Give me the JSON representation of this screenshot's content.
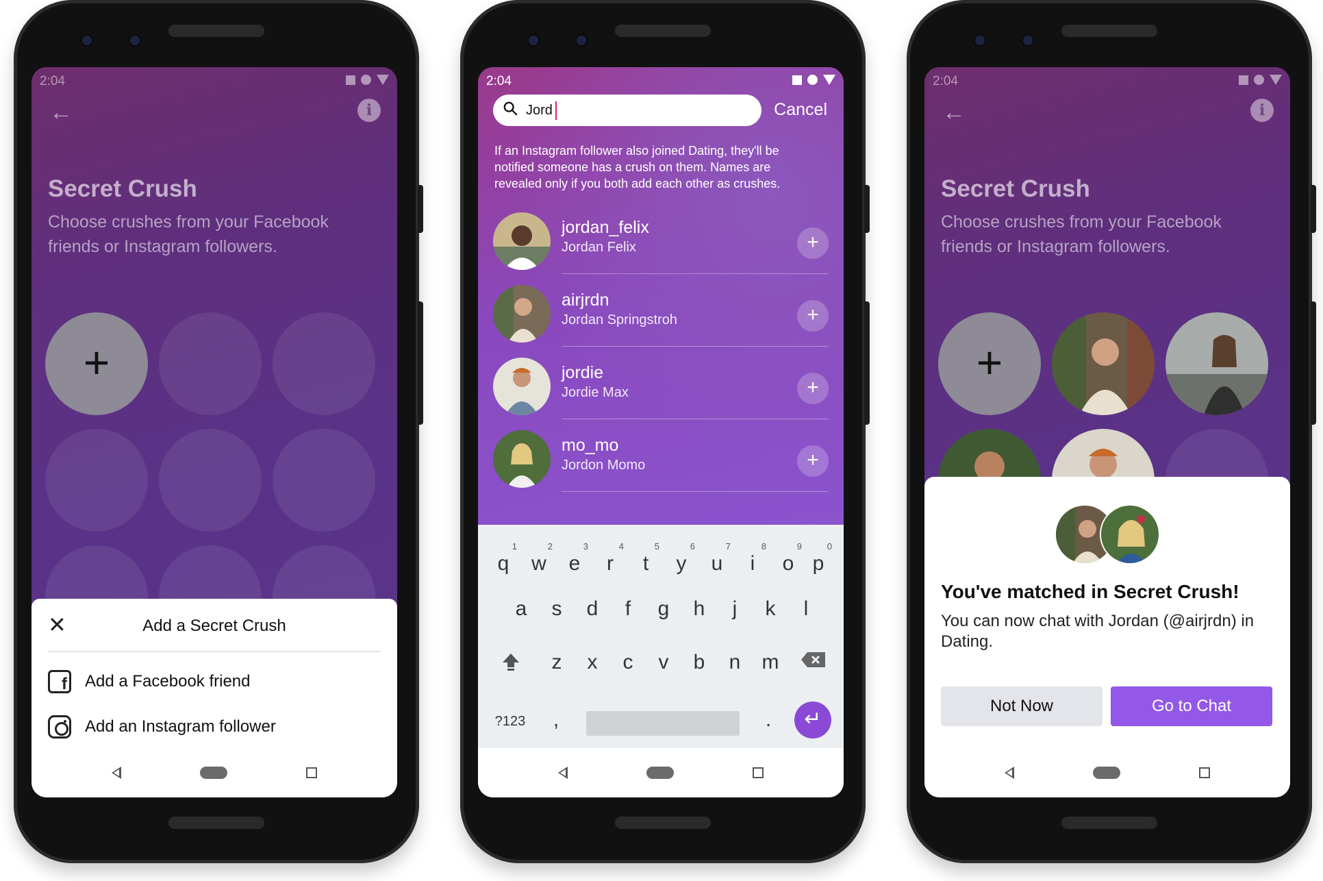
{
  "status_time": "2:04",
  "screen1": {
    "title": "Secret Crush",
    "subtitle": "Choose crushes from your Facebook friends or Instagram followers.",
    "plus": "+",
    "sheet": {
      "close": "✕",
      "title": "Add a Secret Crush",
      "options": [
        {
          "label": "Add a Facebook friend",
          "icon": "facebook-icon"
        },
        {
          "label": "Add an Instagram follower",
          "icon": "instagram-icon"
        }
      ]
    }
  },
  "screen2": {
    "search": {
      "value": "Jord",
      "cancel": "Cancel"
    },
    "notice": "If an Instagram follower also joined Dating, they'll be notified someone has a crush on them. Names are revealed only if you both add each other as crushes.",
    "results": [
      {
        "username": "jordan_felix",
        "name": "Jordan Felix",
        "add": "+"
      },
      {
        "username": "airjrdn",
        "name": "Jordan Springstroh",
        "add": "+"
      },
      {
        "username": "jordie",
        "name": "Jordie Max",
        "add": "+"
      },
      {
        "username": "mo_mo",
        "name": "Jordon Momo",
        "add": "+"
      }
    ],
    "keyboard": {
      "row1": [
        "q",
        "w",
        "e",
        "r",
        "t",
        "y",
        "u",
        "i",
        "o",
        "p"
      ],
      "row1_nums": [
        "1",
        "2",
        "3",
        "4",
        "5",
        "6",
        "7",
        "8",
        "9",
        "0"
      ],
      "row2": [
        "a",
        "s",
        "d",
        "f",
        "g",
        "h",
        "j",
        "k",
        "l"
      ],
      "row3": [
        "z",
        "x",
        "c",
        "v",
        "b",
        "n",
        "m"
      ],
      "symbols": "?123",
      "comma": ",",
      "period": ".",
      "enter": "↵"
    }
  },
  "screen3": {
    "title": "Secret Crush",
    "subtitle": "Choose crushes from your Facebook friends or Instagram followers.",
    "plus": "+",
    "match": {
      "title": "You've matched in Secret Crush!",
      "text": "You can now chat with Jordan (@airjrdn) in Dating.",
      "not_now": "Not Now",
      "go_chat": "Go to Chat"
    }
  },
  "colors": {
    "accent": "#9358e8",
    "keyboard_enter": "#8a4ad6"
  }
}
